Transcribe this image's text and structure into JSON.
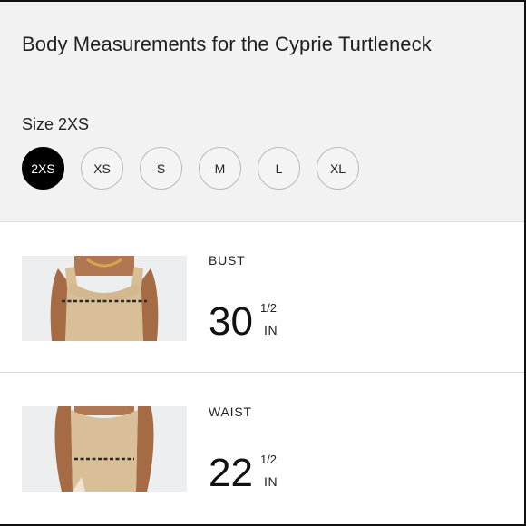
{
  "title": "Body Measurements for the Cyprie Turtleneck",
  "size_label": "Size 2XS",
  "sizes": [
    {
      "label": "2XS",
      "selected": true
    },
    {
      "label": "XS",
      "selected": false
    },
    {
      "label": "S",
      "selected": false
    },
    {
      "label": "M",
      "selected": false
    },
    {
      "label": "L",
      "selected": false
    },
    {
      "label": "XL",
      "selected": false
    }
  ],
  "measurements": {
    "bust": {
      "label": "BUST",
      "whole": "30",
      "fraction": "1/2",
      "unit": "IN"
    },
    "waist": {
      "label": "WAIST",
      "whole": "22",
      "fraction": "1/2",
      "unit": "IN"
    }
  },
  "colors": {
    "header_bg": "#f2f2f2",
    "selected_bg": "#000000",
    "garment": "#d9bf97",
    "skin": "#a06a45",
    "measure_line": "#2a2a2a"
  }
}
